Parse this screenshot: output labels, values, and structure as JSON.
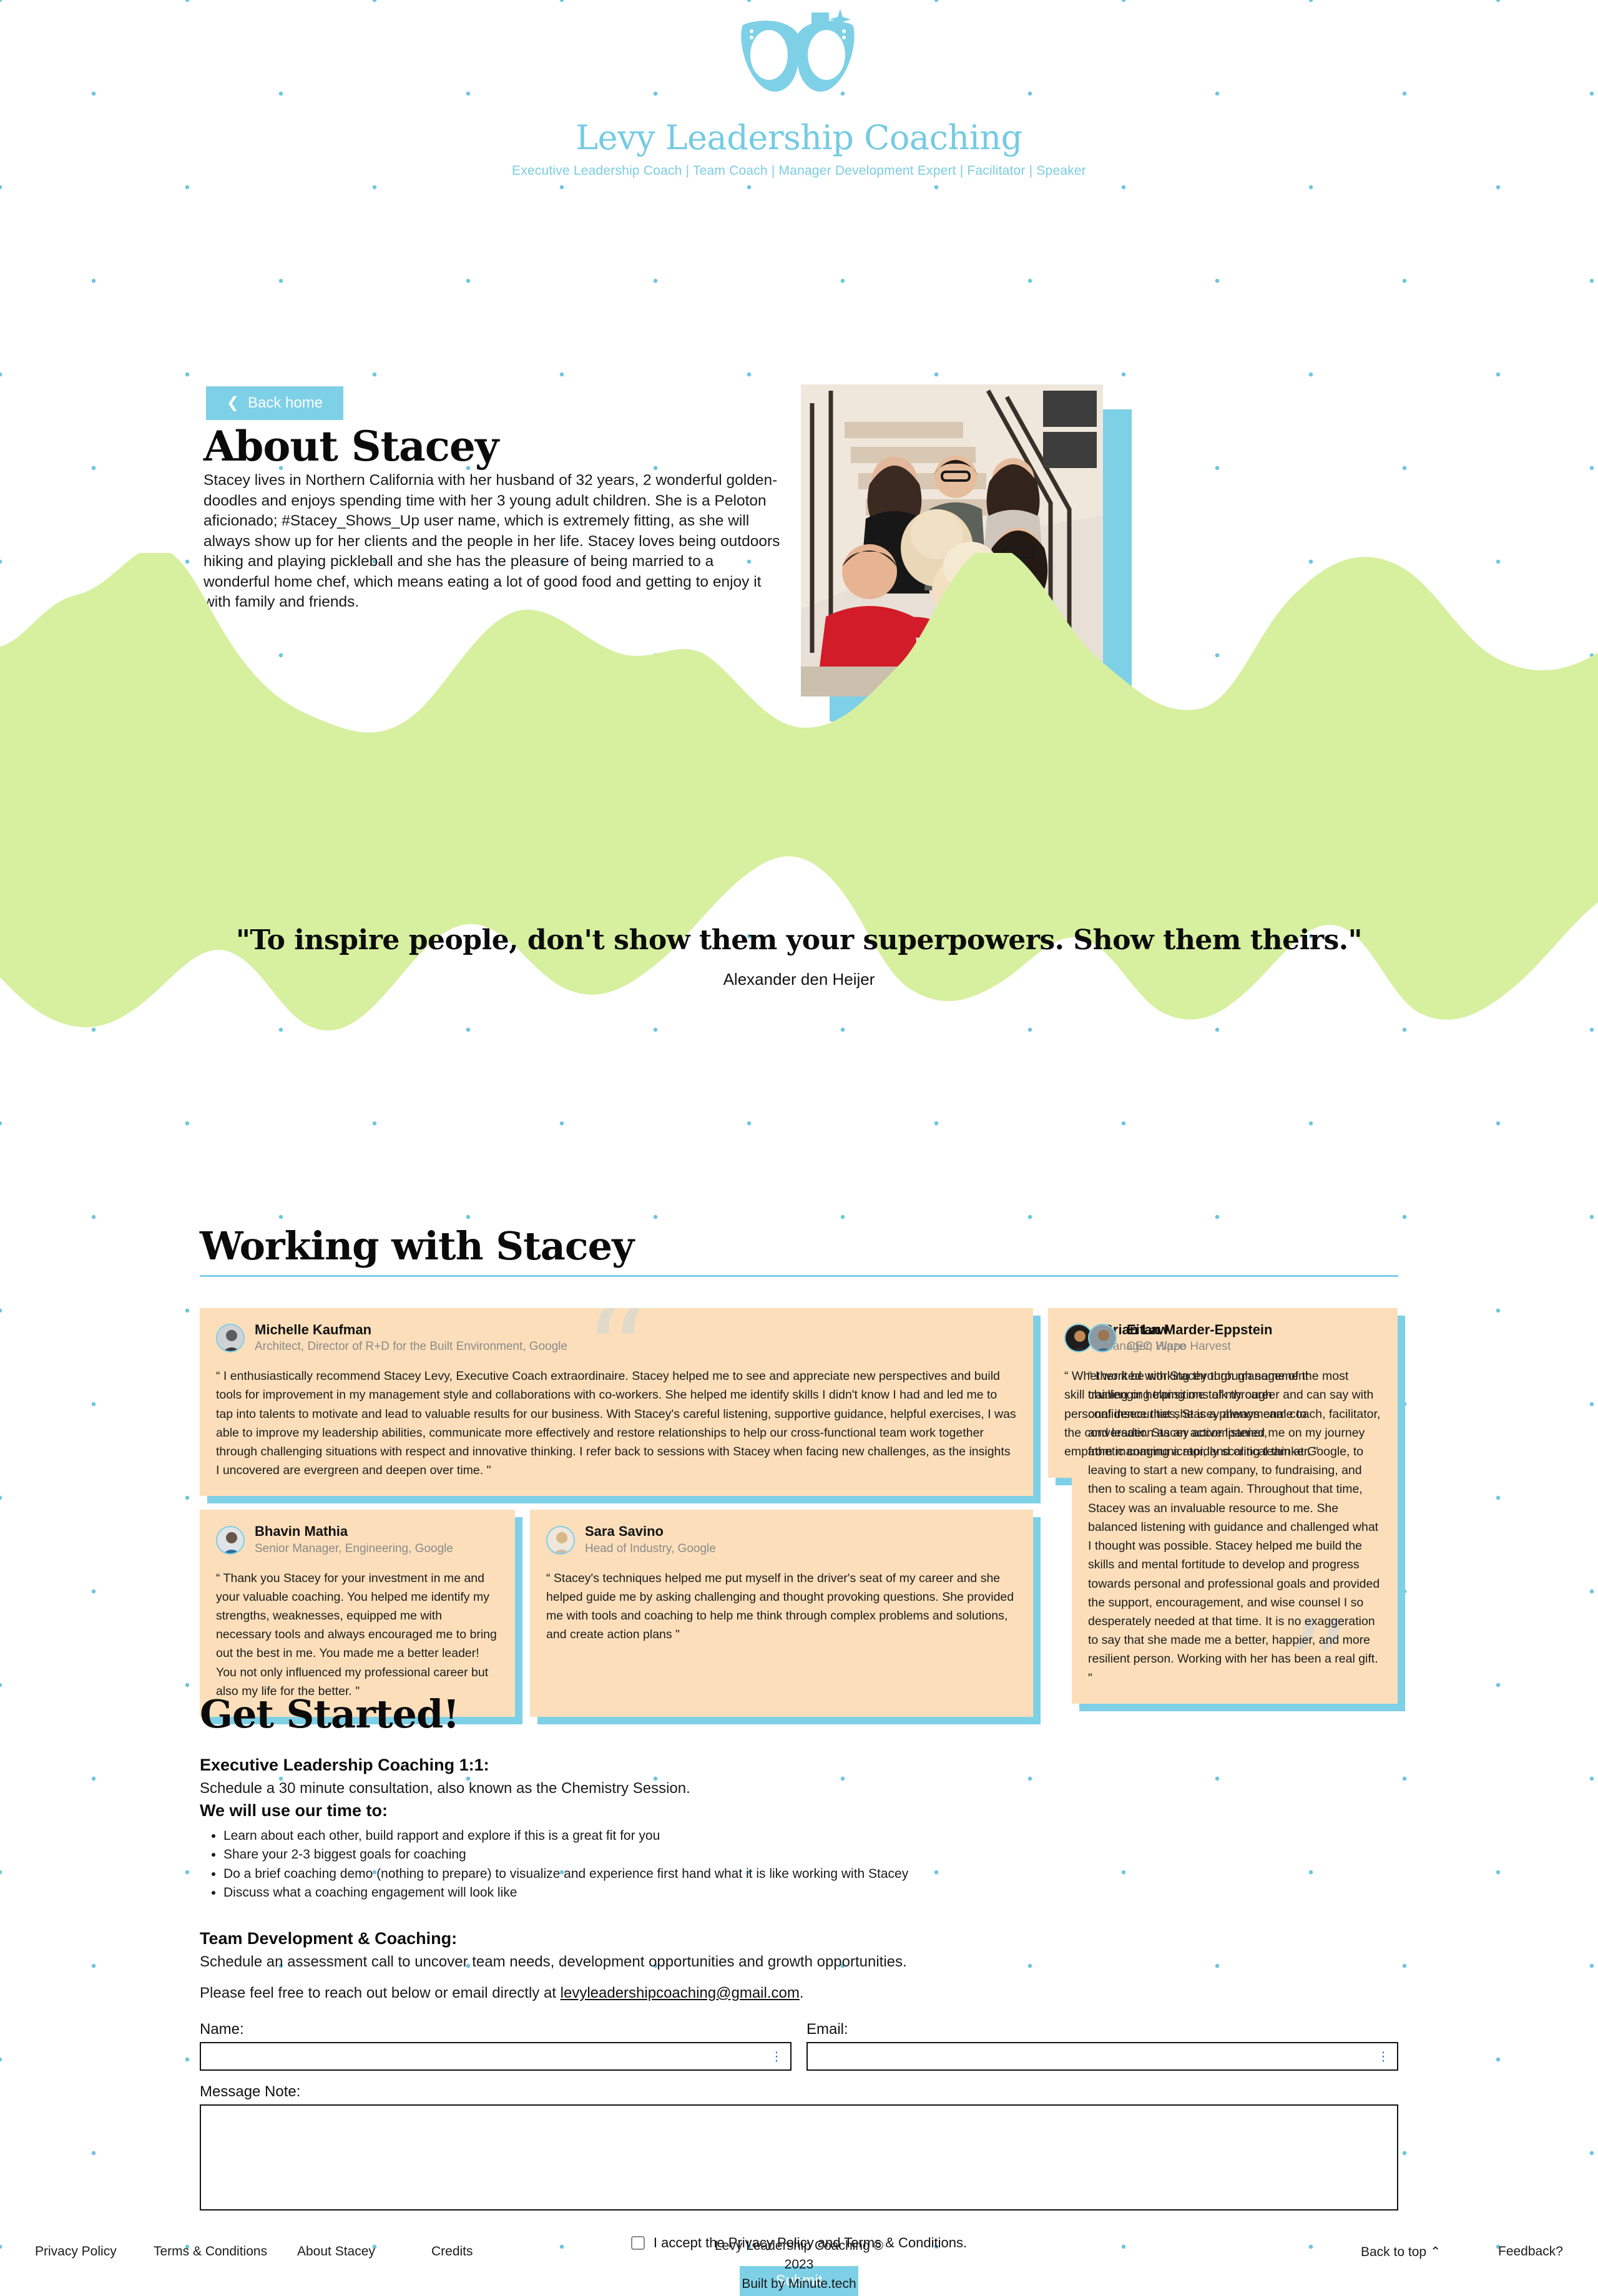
{
  "header": {
    "logo_icon": "cat-eye-glasses-sparkle-icon",
    "brand": "Levy Leadership Coaching",
    "tagline": "Executive Leadership Coach  |  Team Coach  |  Manager Development Expert  |  Facilitator  |  Speaker"
  },
  "about": {
    "back_button": "Back home",
    "back_icon": "chevron-left-icon",
    "title": "About Stacey",
    "body": "Stacey lives in Northern California with her husband of 32 years, 2 wonderful golden-doodles and enjoys spending time with her 3 young adult children. She is a Peloton aficionado; #Stacey_Shows_Up user name, which is extremely fitting, as she will always show up for her clients and the people in her life. Stacey loves being outdoors hiking and playing pickleball and she has the pleasure of being married to a wonderful home chef, which means eating a lot of good food and getting to enjoy it with family and friends.",
    "photo_alt": "family-photo-on-staircase"
  },
  "quote": {
    "text": "\"To inspire people, don't show them your superpowers. Show them theirs.\"",
    "author": "Alexander den Heijer"
  },
  "working": {
    "title": "Working with Stacey",
    "testimonials": [
      {
        "name": "Michelle Kaufman",
        "role": "Architect, Director of R+D for the Built Environment, Google",
        "text": "“ I enthusiastically recommend Stacey Levy, Executive Coach extraordinaire. Stacey helped me to see and appreciate new perspectives and build tools for improvement in my management style and collaborations with co-workers. She helped me identify skills I didn't know I had and led me to tap into talents to motivate and lead to valuable results for our business. With Stacey's careful listening, supportive guidance, helpful exercises, I was able to improve my leadership abilities, communicate more effectively and restore relationships to help our cross-functional team work together through challenging situations with respect and innovative thinking. I refer back to sessions with Stacey when facing new challenges, as the insights I uncovered are evergreen and deepen over time. \""
      },
      {
        "name": "Brian Law",
        "role": "Manager, Waze",
        "text": "“ Whether it be working through management skill training or helping me talk through personal insecurities, Stacey always came to the conversation as an active listener, empathetic communicator, and critical thinker. \""
      },
      {
        "name": "Eitan Marder-Eppstein",
        "role": "CEO Hippo Harvest",
        "text": "“ I worked with Stacey through some of the most challenging transitions of my career and can say with confidence that she is a phenomenal coach, facilitator, and leader. Stacey accompanied me on my journey from managing a rapidly scaling team at Google, to leaving to start a new company, to fundraising, and then to scaling a team again. Throughout that time, Stacey was an invaluable resource to me. She balanced listening with guidance and challenged what I thought was possible. Stacey helped me build the skills and mental fortitude to develop and progress towards personal and professional goals and provided the support, encouragement, and wise counsel I so desperately needed at that time. It is no exaggeration to say that she made me a better, happier, and more resilient person. Working with her has been a real gift. \""
      },
      {
        "name": "Bhavin Mathia",
        "role": "Senior Manager, Engineering, Google",
        "text": "“ Thank you Stacey for your investment in me and your valuable coaching. You helped me identify my strengths, weaknesses, equipped me with necessary tools and always encouraged me to bring out the best in me. You made me a better leader! You not only influenced my professional career but also my life for the better. \""
      },
      {
        "name": "Sara Savino",
        "role": "Head of Industry, Google",
        "text": "“ Stacey's techniques helped me put myself in the driver's seat of my career and she helped guide me by asking challenging and thought provoking questions. She provided me with tools and coaching to help me think through complex problems and solutions, and create action plans \""
      }
    ]
  },
  "get_started": {
    "title": "Get Started!",
    "exec_heading": "Executive Leadership Coaching 1:1:",
    "exec_sub": "Schedule a 30 minute consultation, also known as the Chemistry Session.",
    "time_heading": "We will use our time to:",
    "bullets": [
      "Learn about each other, build rapport and explore if this is a great fit for you",
      "Share your 2-3 biggest goals for coaching",
      "Do a brief coaching demo (nothing to prepare) to visualize and experience first hand what it is like working with Stacey",
      "Discuss what a coaching engagement will look like"
    ],
    "team_heading": "Team Development & Coaching:",
    "team_sub": "Schedule an assessment call to uncover team needs, development opportunities and growth opportunities.",
    "reach_out_prefix": "Please feel free to reach out below or email directly at ",
    "reach_out_email": "levyleadershipcoaching@gmail.com",
    "reach_out_suffix": "."
  },
  "form": {
    "name_label": "Name:",
    "name_value": "",
    "name_placeholder": "",
    "email_label": "Email:",
    "email_value": "",
    "email_placeholder": "",
    "message_label": "Message Note:",
    "message_value": "",
    "message_placeholder": "",
    "accept_label": "I accept the Privacy Policy and Terms & Conditions.",
    "accept_checked": false,
    "submit_label": "Submit"
  },
  "footer": {
    "privacy": "Privacy Policy",
    "terms": "Terms & Conditions",
    "about": "About Stacey",
    "credits": "Credits",
    "copyright": "Levy Leadership Coaching © 2023",
    "built_by": "Built by Minute.tech",
    "back_to_top": "Back to top ⌃",
    "feedback": "Feedback?"
  },
  "colors": {
    "brand_blue": "#7ED0E6",
    "wave_green": "#D6F0A0",
    "card_peach": "#FCDFBA",
    "dot_blue": "#6EC6DF"
  }
}
